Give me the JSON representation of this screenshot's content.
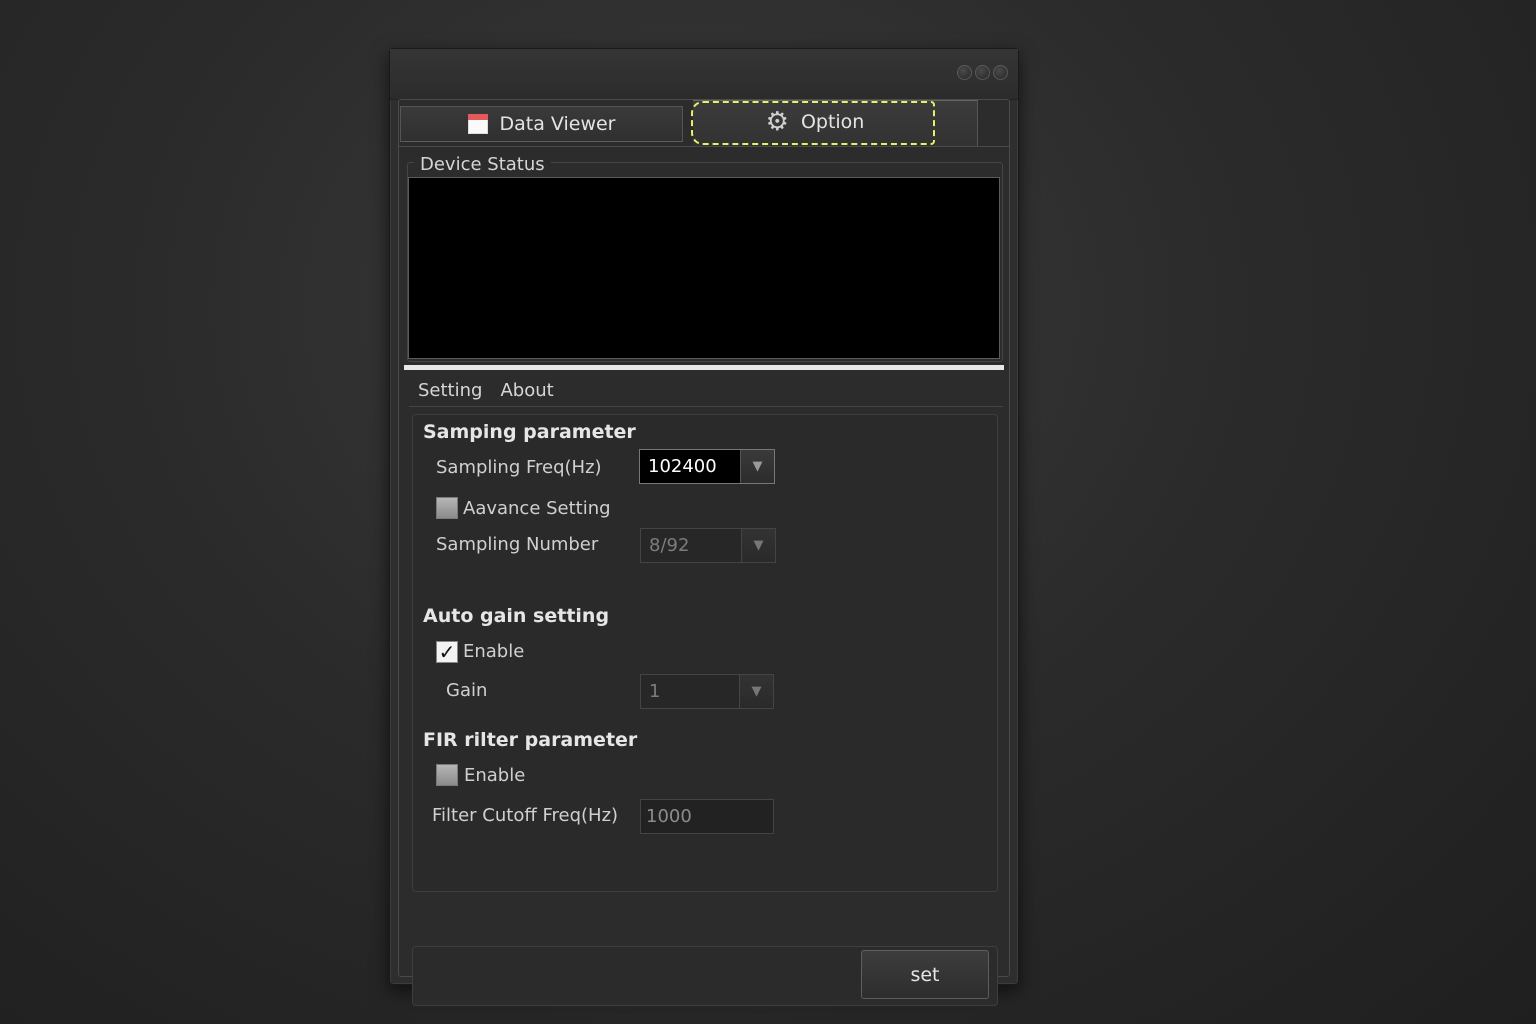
{
  "tabs": {
    "data_viewer": "Data Viewer",
    "option": "Option"
  },
  "device_status": {
    "title": "Device Status"
  },
  "subtabs": {
    "setting": "Setting",
    "about": "About"
  },
  "sampling": {
    "title": "Samping parameter",
    "freq_label": "Sampling Freq(Hz)",
    "freq_value": "102400",
    "advance_label": "Aavance Setting",
    "advance_checked": false,
    "number_label": "Sampling Number",
    "number_value": "8/92"
  },
  "auto_gain": {
    "title": "Auto gain setting",
    "enable_label": "Enable",
    "enable_checked": true,
    "check_glyph": "✓",
    "gain_label": "Gain",
    "gain_value": "1"
  },
  "fir": {
    "title": "FIR rilter parameter",
    "enable_label": "Enable",
    "enable_checked": false,
    "cutoff_label": "Filter Cutoff Freq(Hz)",
    "cutoff_value": "1000"
  },
  "footer": {
    "set_label": "set"
  },
  "icons": {
    "gear": "⚙",
    "dropdown": "▼"
  },
  "colors": {
    "focus_ring": "#e8f06a",
    "calendar_header": "#e25a5a"
  }
}
